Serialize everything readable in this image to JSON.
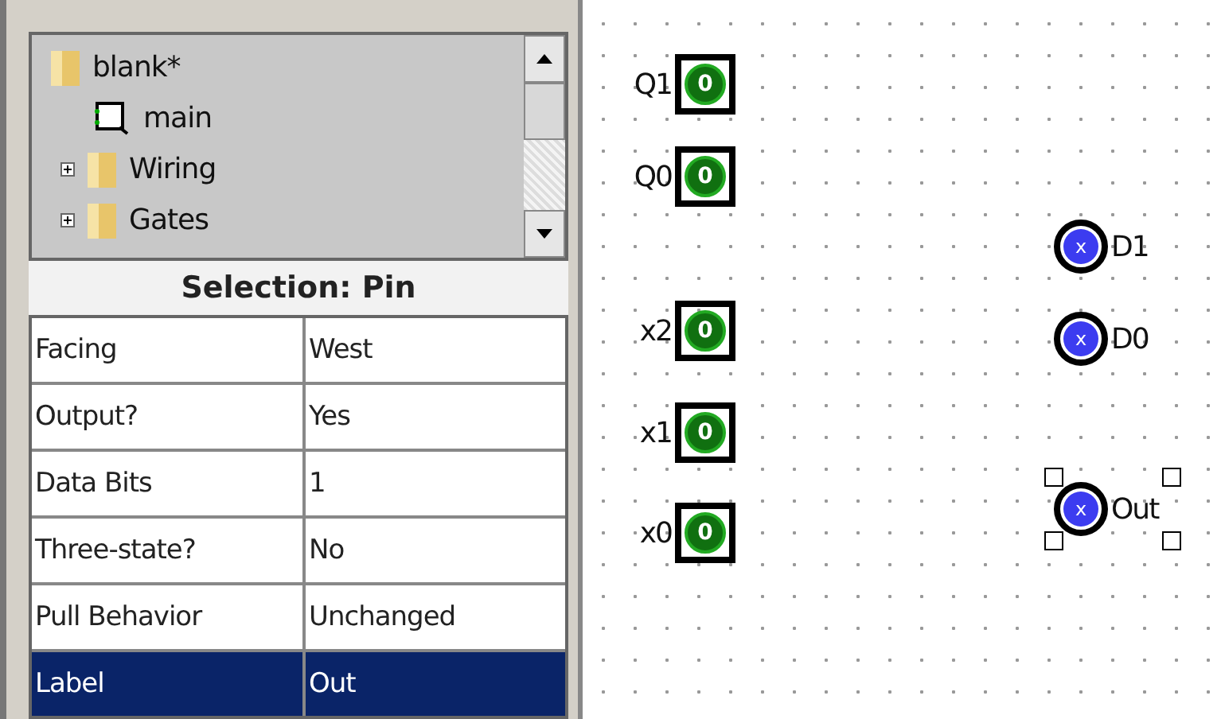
{
  "explorer": {
    "items": [
      {
        "label": "blank*",
        "kind": "folder",
        "expanded": true,
        "children": [
          {
            "label": "main",
            "kind": "circuit"
          }
        ]
      },
      {
        "label": "Wiring",
        "kind": "folder",
        "expanded": false
      },
      {
        "label": "Gates",
        "kind": "folder",
        "expanded": false
      }
    ]
  },
  "attributes": {
    "title": "Selection: Pin",
    "rows": [
      {
        "name": "Facing",
        "value": "West",
        "selected": false
      },
      {
        "name": "Output?",
        "value": "Yes",
        "selected": false
      },
      {
        "name": "Data Bits",
        "value": "1",
        "selected": false
      },
      {
        "name": "Three-state?",
        "value": "No",
        "selected": false
      },
      {
        "name": "Pull Behavior",
        "value": "Unchanged",
        "selected": false
      },
      {
        "name": "Label",
        "value": "Out",
        "selected": true
      }
    ]
  },
  "canvas": {
    "pins": [
      {
        "kind": "input",
        "label": "Q1",
        "value": "0",
        "selected": false
      },
      {
        "kind": "input",
        "label": "Q0",
        "value": "0",
        "selected": false
      },
      {
        "kind": "output",
        "label": "D1",
        "value": "x",
        "selected": false
      },
      {
        "kind": "input",
        "label": "x2",
        "value": "0",
        "selected": false
      },
      {
        "kind": "output",
        "label": "D0",
        "value": "x",
        "selected": false
      },
      {
        "kind": "input",
        "label": "x1",
        "value": "0",
        "selected": false
      },
      {
        "kind": "output",
        "label": "Out",
        "value": "x",
        "selected": true
      },
      {
        "kind": "input",
        "label": "x0",
        "value": "0",
        "selected": false
      }
    ]
  }
}
